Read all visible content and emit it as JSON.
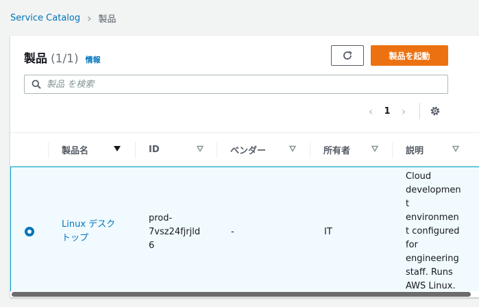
{
  "breadcrumb": {
    "root": "Service Catalog",
    "current": "製品"
  },
  "header": {
    "title": "製品",
    "count": "(1/1)",
    "info": "情報",
    "launch_label": "製品を起動"
  },
  "search": {
    "placeholder": "製品 を検索"
  },
  "pagination": {
    "current_page": "1"
  },
  "columns": [
    "製品名",
    "ID",
    "ベンダー",
    "所有者",
    "説明"
  ],
  "rows": [
    {
      "selected": true,
      "name": [
        "Linux デスク",
        "トップ"
      ],
      "id": [
        "prod-",
        "7vsz24fjrjld",
        "6"
      ],
      "vendor": "-",
      "owner": "IT",
      "description": [
        "Cloud",
        "developmen",
        "t",
        "environmen",
        "t configured",
        "for",
        "engineering",
        "staff. Runs",
        "AWS Linux."
      ]
    }
  ],
  "colors": {
    "link": "#0073bb",
    "primary_button": "#ec7211",
    "selected_row": "#f1faff",
    "selected_border": "#00a1c9"
  }
}
